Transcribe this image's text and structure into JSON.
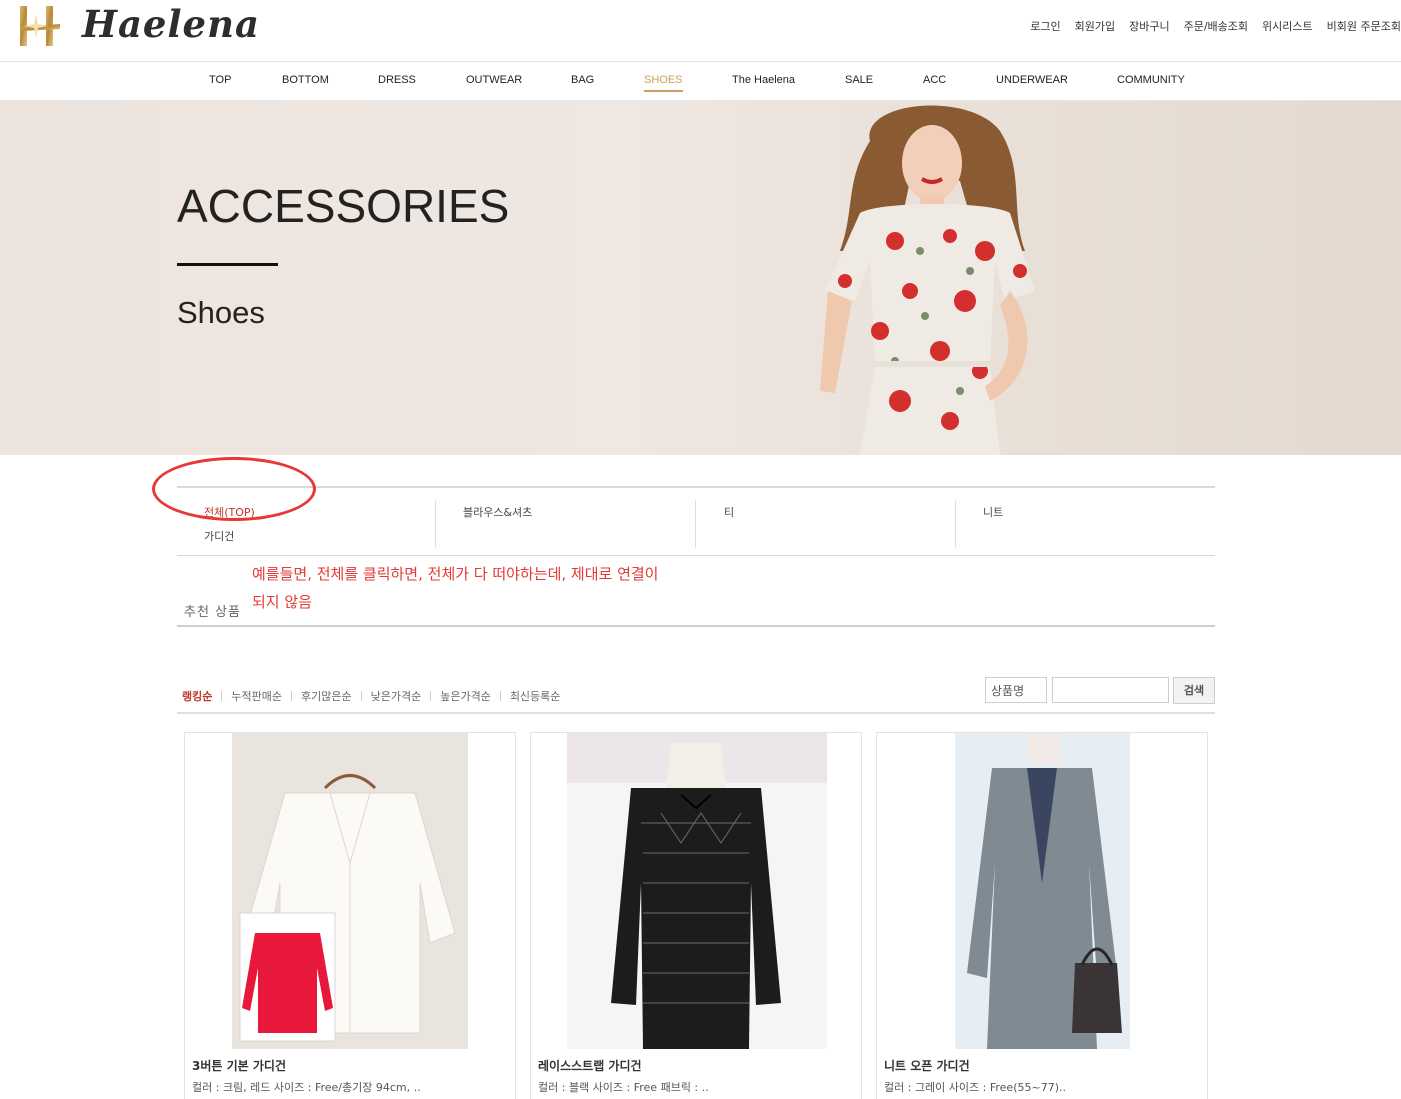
{
  "header": {
    "logo_text": "Haelena",
    "util_links": [
      "로그인",
      "회원가입",
      "장바구니",
      "주문/배송조회",
      "위시리스트",
      "비회원 주문조회"
    ]
  },
  "gnb": {
    "items": [
      "TOP",
      "BOTTOM",
      "DRESS",
      "OUTWEAR",
      "BAG",
      "SHOES",
      "The Haelena",
      "SALE",
      "ACC",
      "UNDERWEAR",
      "COMMUNITY"
    ],
    "active": "SHOES"
  },
  "banner": {
    "title": "ACCESSORIES",
    "subtitle": "Shoes"
  },
  "categories": {
    "items": [
      "전체(TOP)",
      "블라우스&셔츠",
      "티",
      "니트",
      "가디건"
    ],
    "active": "전체(TOP)"
  },
  "annotation": {
    "note": "예를들면, 전체를 클릭하면, 전체가 다 떠야하는데, 제대로 연결이 되지 않음"
  },
  "recommend": {
    "title": "추천 상품"
  },
  "sort": {
    "options": [
      "랭킹순",
      "누적판매순",
      "후기많은순",
      "낮은가격순",
      "높은가격순",
      "최신등록순"
    ],
    "active": "랭킹순"
  },
  "search": {
    "select_value": "상품명",
    "input_value": "",
    "button_label": "검색"
  },
  "products": [
    {
      "name": "3버튼 기본 가디건",
      "desc": "컬러 : 크림, 레드 사이즈 : Free/총기장 94cm, .."
    },
    {
      "name": "레이스스트랩 가디건",
      "desc": "컬러 : 블랙 사이즈 : Free 패브릭 : .."
    },
    {
      "name": "니트 오픈 가디건",
      "desc": "컬러 : 그레이 사이즈 : Free(55~77).."
    }
  ],
  "colors": {
    "accent_gold": "#c9a15a",
    "active_red": "#c0392b",
    "annotation_red": "#e53935"
  }
}
